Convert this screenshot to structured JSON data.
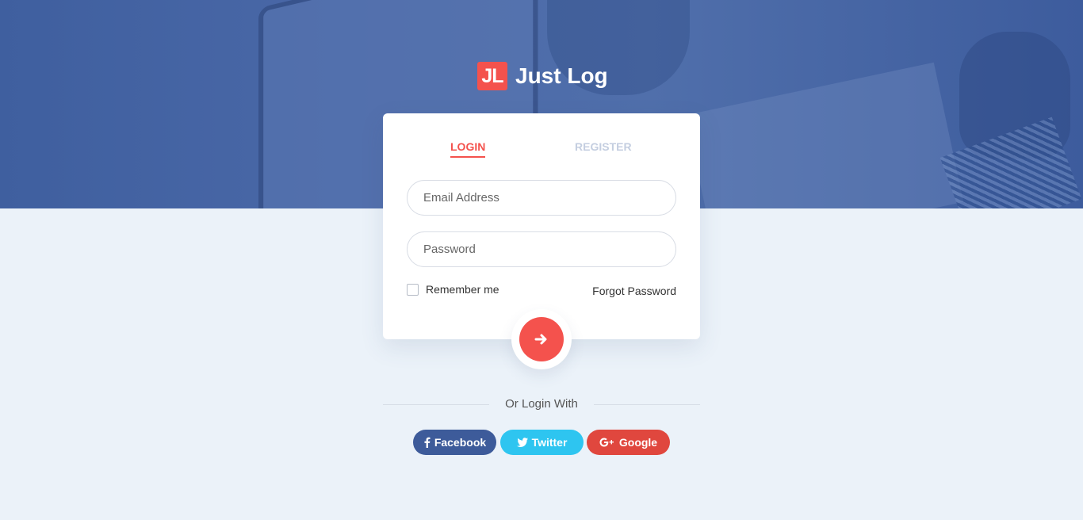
{
  "brand": {
    "badge": "JL",
    "name": "Just Log"
  },
  "tabs": {
    "login": "LOGIN",
    "register": "REGISTER"
  },
  "form": {
    "email_placeholder": "Email Address",
    "password_placeholder": "Password",
    "remember_label": "Remember me",
    "remember_checked": false,
    "forgot_label": "Forgot Password",
    "submit_icon": "arrow-right-icon"
  },
  "social": {
    "divider_text": "Or Login With",
    "facebook": "Facebook",
    "twitter": "Twitter",
    "google": "Google"
  },
  "colors": {
    "accent": "#f4524d",
    "hero": "#4b69a8",
    "background": "#ebf2f9",
    "facebook": "#3d5b9a",
    "twitter": "#2ec5f0",
    "google": "#e0473e",
    "tab_inactive": "#c4cee0"
  }
}
